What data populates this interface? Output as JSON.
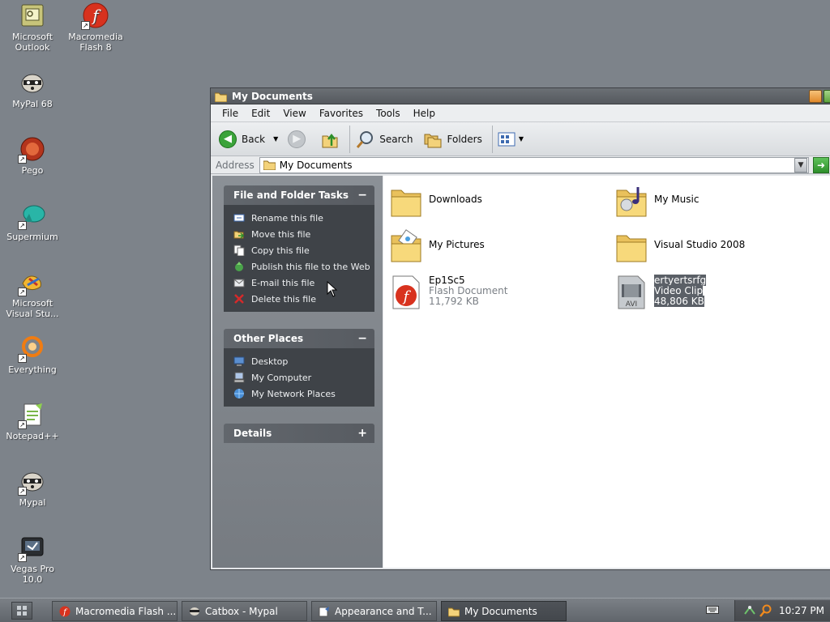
{
  "desktop": {
    "icons": [
      {
        "label": "Microsoft Outlook",
        "icon": "outlook-icon",
        "shortcut": false
      },
      {
        "label": "Macromedia Flash 8",
        "icon": "flash-icon",
        "shortcut": true
      },
      {
        "label": "MyPal 68",
        "icon": "raccoon-icon",
        "shortcut": false
      },
      {
        "label": "Pego",
        "icon": "pego-icon",
        "shortcut": true
      },
      {
        "label": "Supermium",
        "icon": "supermium-icon",
        "shortcut": true
      },
      {
        "label": "Microsoft Visual Stu...",
        "icon": "visual-studio-icon",
        "shortcut": true
      },
      {
        "label": "Everything",
        "icon": "everything-icon",
        "shortcut": true
      },
      {
        "label": "Notepad++",
        "icon": "notepadpp-icon",
        "shortcut": true
      },
      {
        "label": "Mypal",
        "icon": "raccoon-icon",
        "shortcut": true
      },
      {
        "label": "Vegas Pro 10.0",
        "icon": "vegas-icon",
        "shortcut": true
      }
    ]
  },
  "window": {
    "title": "My Documents",
    "menu": [
      "File",
      "Edit",
      "View",
      "Favorites",
      "Tools",
      "Help"
    ],
    "toolbar": {
      "back_label": "Back",
      "search_label": "Search",
      "folders_label": "Folders"
    },
    "address": {
      "label": "Address",
      "value": "My Documents"
    }
  },
  "taskpane": {
    "file_tasks": {
      "title": "File and Folder Tasks",
      "toggle": "−",
      "items": [
        {
          "label": "Rename this file",
          "icon": "rename-icon"
        },
        {
          "label": "Move this file",
          "icon": "move-icon"
        },
        {
          "label": "Copy this file",
          "icon": "copy-icon"
        },
        {
          "label": "Publish this file to the Web",
          "icon": "publish-icon"
        },
        {
          "label": "E-mail this file",
          "icon": "email-icon"
        },
        {
          "label": "Delete this file",
          "icon": "delete-icon"
        }
      ]
    },
    "other_places": {
      "title": "Other Places",
      "toggle": "−",
      "items": [
        {
          "label": "Desktop",
          "icon": "desktop-icon"
        },
        {
          "label": "My Computer",
          "icon": "my-computer-icon"
        },
        {
          "label": "My Network Places",
          "icon": "network-places-icon"
        }
      ]
    },
    "details": {
      "title": "Details",
      "toggle": "+"
    }
  },
  "files": [
    {
      "name": "Downloads",
      "type": "",
      "size": "",
      "icon": "folder-icon",
      "selected": false
    },
    {
      "name": "My Music",
      "type": "",
      "size": "",
      "icon": "music-folder-icon",
      "selected": false
    },
    {
      "name": "My Pictures",
      "type": "",
      "size": "",
      "icon": "pictures-folder-icon",
      "selected": false
    },
    {
      "name": "Visual Studio 2008",
      "type": "",
      "size": "",
      "icon": "folder-icon",
      "selected": false
    },
    {
      "name": "Ep1Sc5",
      "type": "Flash Document",
      "size": "11,792 KB",
      "icon": "flash-document-icon",
      "selected": false
    },
    {
      "name": "ertyertsrfg",
      "type": "Video Clip",
      "size": "48,806 KB",
      "icon": "avi-file-icon",
      "selected": true
    }
  ],
  "taskbar": {
    "buttons": [
      {
        "label": "Macromedia Flash ...",
        "icon": "flash-icon",
        "active": false
      },
      {
        "label": "Catbox - Mypal",
        "icon": "raccoon-icon",
        "active": false
      },
      {
        "label": "Appearance and T...",
        "icon": "control-panel-icon",
        "active": false
      },
      {
        "label": "My Documents",
        "icon": "folder-icon",
        "active": true
      }
    ],
    "clock": "10:27 PM"
  }
}
